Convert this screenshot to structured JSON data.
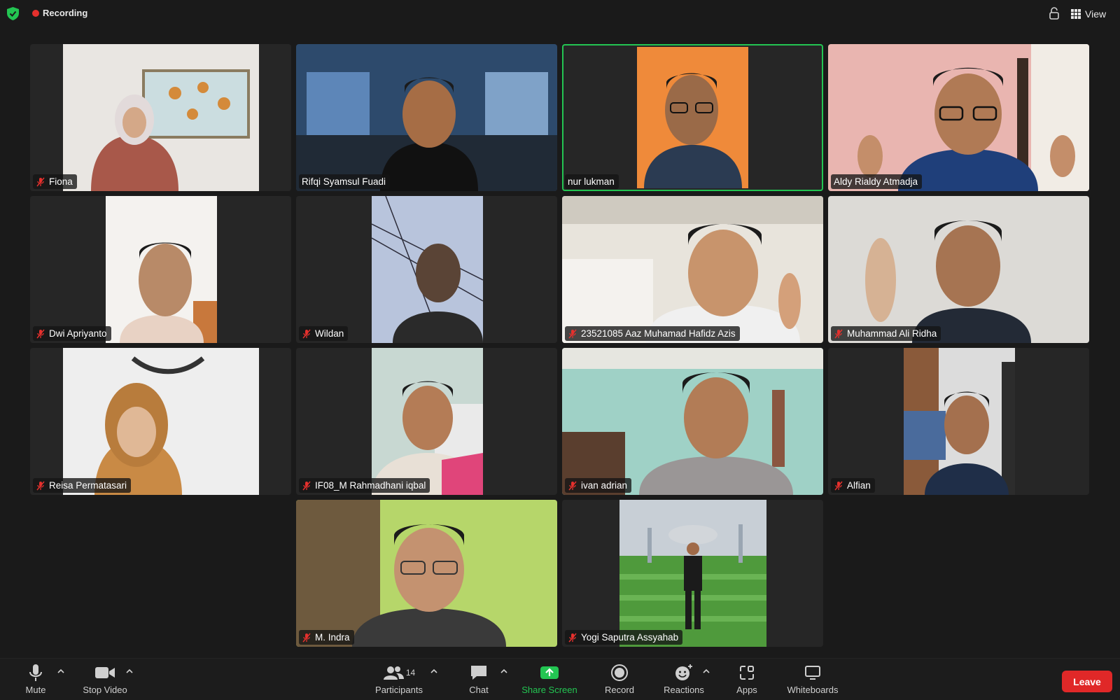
{
  "top_bar": {
    "recording_label": "Recording",
    "view_label": "View"
  },
  "participants": [
    {
      "name": "Fiona",
      "muted": true
    },
    {
      "name": "Rifqi Syamsul Fuadi",
      "muted": false
    },
    {
      "name": "nur lukman",
      "muted": false,
      "active_speaker": true
    },
    {
      "name": "Aldy Rialdy Atmadja",
      "muted": false
    },
    {
      "name": "Dwi Apriyanto",
      "muted": true
    },
    {
      "name": "Wildan",
      "muted": true
    },
    {
      "name": "23521085 Aaz Muhamad Hafidz Azis",
      "muted": true
    },
    {
      "name": "Muhammad Ali Ridha",
      "muted": true
    },
    {
      "name": "Reisa Permatasari",
      "muted": true
    },
    {
      "name": "IF08_M Rahmadhani iqbal",
      "muted": true
    },
    {
      "name": "ivan adrian",
      "muted": true
    },
    {
      "name": "Alfian",
      "muted": true
    },
    {
      "name": "M. Indra",
      "muted": true
    },
    {
      "name": "Yogi Saputra Assyahab",
      "muted": true
    }
  ],
  "toolbar": {
    "mute_label": "Mute",
    "stop_video_label": "Stop Video",
    "participants_label": "Participants",
    "participants_count": "14",
    "chat_label": "Chat",
    "share_screen_label": "Share Screen",
    "record_label": "Record",
    "reactions_label": "Reactions",
    "apps_label": "Apps",
    "whiteboards_label": "Whiteboards",
    "leave_label": "Leave"
  },
  "colors": {
    "background": "#1a1a1a",
    "tile_background": "#262626",
    "active_speaker_border": "#23c552",
    "recording_dot": "#e5302d",
    "share_screen_green": "#23c552",
    "leave_red": "#e02828",
    "mute_icon_red": "#e5302d"
  },
  "icons": {
    "security": "shield-check-icon",
    "view": "grid-icon",
    "mute": "microphone-icon",
    "video": "video-camera-icon",
    "participants": "people-icon",
    "chat": "speech-bubble-icon",
    "share": "share-arrow-icon",
    "record": "record-circle-icon",
    "reactions": "smiley-plus-icon",
    "apps": "apps-icon",
    "whiteboards": "whiteboard-icon",
    "muted_mic": "mic-off-icon"
  }
}
